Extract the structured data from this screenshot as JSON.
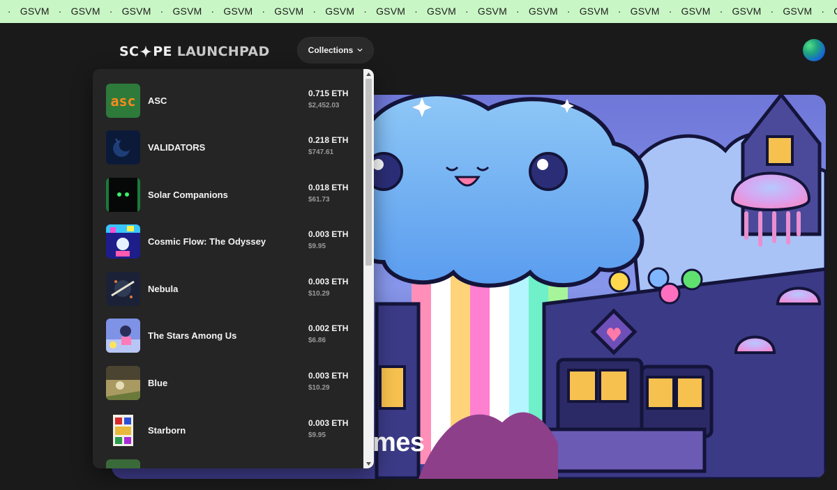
{
  "ticker": {
    "items": [
      "M",
      "GSVM",
      "GSVM",
      "GSVM",
      "GSVM",
      "GSVM",
      "GSVM",
      "GSVM",
      "GSVM",
      "GSVM",
      "GSVM",
      "GSVM",
      "GSVM",
      "GSVM",
      "GSVM",
      "GSVM",
      "GSVM",
      "GSVM",
      "GSVM",
      "GSVM",
      "GSVM"
    ],
    "separator": "·",
    "background": "#c9f6c5"
  },
  "header": {
    "logo_part1": "SC",
    "logo_part2": "PE",
    "logo_part3": "LAUNCHPAD",
    "collections_label": "Collections"
  },
  "hero": {
    "title_fragment": "mes"
  },
  "collections": [
    {
      "name": "ASC",
      "eth": "0.715 ETH",
      "usd": "$2,452.03",
      "thumb_icon": "asc-logo-thumbnail"
    },
    {
      "name": "VALIDATORS",
      "eth": "0.218 ETH",
      "usd": "$747.61",
      "thumb_icon": "validators-thumbnail"
    },
    {
      "name": "Solar Companions",
      "eth": "0.018 ETH",
      "usd": "$61.73",
      "thumb_icon": "solar-companions-thumbnail"
    },
    {
      "name": "Cosmic Flow: The Odyssey",
      "eth": "0.003 ETH",
      "usd": "$9.95",
      "thumb_icon": "cosmic-flow-thumbnail"
    },
    {
      "name": "Nebula",
      "eth": "0.003 ETH",
      "usd": "$10.29",
      "thumb_icon": "nebula-thumbnail"
    },
    {
      "name": "The Stars Among Us",
      "eth": "0.002 ETH",
      "usd": "$6.86",
      "thumb_icon": "stars-among-us-thumbnail"
    },
    {
      "name": "Blue",
      "eth": "0.003 ETH",
      "usd": "$10.29",
      "thumb_icon": "blue-thumbnail"
    },
    {
      "name": "Starborn",
      "eth": "0.003 ETH",
      "usd": "$9.95",
      "thumb_icon": "starborn-thumbnail"
    }
  ],
  "asc_thumb_text": "asc",
  "colors": {
    "background": "#1a1a1a",
    "dropdown": "#252525",
    "accent_green": "#c9f6c5"
  }
}
